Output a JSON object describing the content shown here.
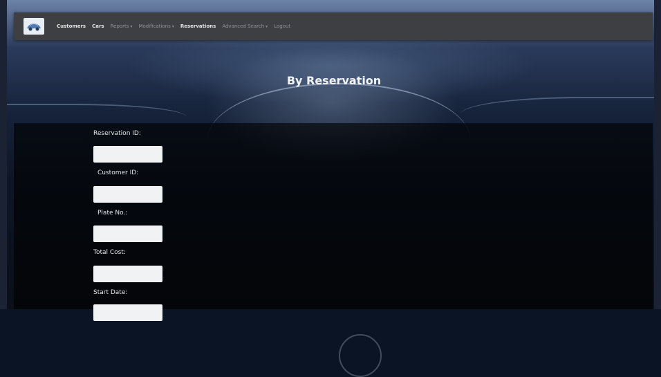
{
  "navbar": {
    "items": [
      {
        "label": "Customers",
        "dropdown": false,
        "active": true
      },
      {
        "label": "Cars",
        "dropdown": false,
        "active": true
      },
      {
        "label": "Reports",
        "dropdown": true,
        "active": false
      },
      {
        "label": "Modifications",
        "dropdown": true,
        "active": false
      },
      {
        "label": "Reservations",
        "dropdown": false,
        "active": true
      },
      {
        "label": "Advanced Search",
        "dropdown": true,
        "active": false
      },
      {
        "label": "Logout",
        "dropdown": false,
        "active": false
      }
    ],
    "caret": "▾"
  },
  "page": {
    "title": "By Reservation"
  },
  "form": {
    "fields": [
      {
        "label": "Reservation ID:",
        "value": "",
        "placeholder": ""
      },
      {
        "label": "Customer ID:",
        "value": "",
        "placeholder": ""
      },
      {
        "label": "Plate No.:",
        "value": "",
        "placeholder": ""
      },
      {
        "label": "Total Cost:",
        "value": "",
        "placeholder": ""
      },
      {
        "label": "Start Date:",
        "value": "",
        "placeholder": ""
      }
    ]
  },
  "colors": {
    "navbar_bg": "#3e3f42",
    "panel_bg": "rgba(0,0,0,0.62)",
    "input_bg": "#f1f2f4"
  }
}
